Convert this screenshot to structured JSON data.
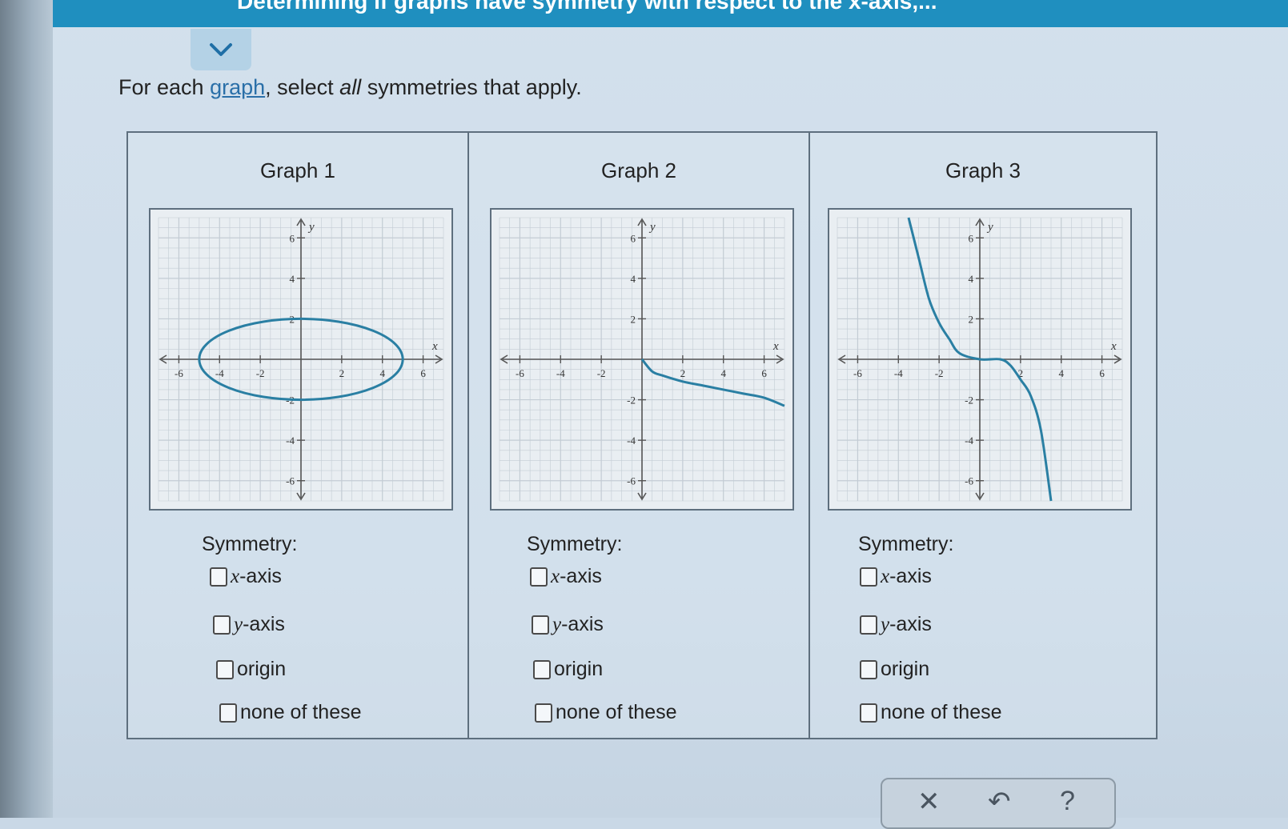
{
  "header": {
    "title": "Determining if graphs have symmetry with respect to the x-axis,..."
  },
  "prompt": {
    "before": "For each ",
    "link": "graph",
    "middle": ", select ",
    "emphasis": "all",
    "after": " symmetries that apply."
  },
  "graphs": [
    {
      "title": "Graph 1",
      "symmetry_label": "Symmetry:",
      "options": [
        "x-axis",
        "y-axis",
        "origin",
        "none of these"
      ],
      "checked": [
        false,
        false,
        false,
        false
      ]
    },
    {
      "title": "Graph 2",
      "symmetry_label": "Symmetry:",
      "options": [
        "x-axis",
        "y-axis",
        "origin",
        "none of these"
      ],
      "checked": [
        false,
        false,
        false,
        false
      ]
    },
    {
      "title": "Graph 3",
      "symmetry_label": "Symmetry:",
      "options": [
        "x-axis",
        "y-axis",
        "origin",
        "none of these"
      ],
      "checked": [
        false,
        false,
        false,
        false
      ]
    }
  ],
  "axis": {
    "x_label": "x",
    "y_label": "y",
    "x_ticks": [
      "-6",
      "-4",
      "-2",
      "2",
      "4",
      "6"
    ],
    "y_ticks": [
      "6",
      "4",
      "2",
      "-2",
      "-4",
      "-6"
    ]
  },
  "chart_data": [
    {
      "type": "line",
      "title": "Graph 1",
      "xlabel": "x",
      "ylabel": "y",
      "xlim": [
        -7,
        7
      ],
      "ylim": [
        -7,
        7
      ],
      "grid": true,
      "series": [
        {
          "shape": "ellipse",
          "center": [
            0,
            0
          ],
          "rx": 5,
          "ry": 2
        }
      ]
    },
    {
      "type": "line",
      "title": "Graph 2",
      "xlabel": "x",
      "ylabel": "y",
      "xlim": [
        -7,
        7
      ],
      "ylim": [
        -7,
        7
      ],
      "grid": true,
      "series": [
        {
          "x": [
            0,
            0.5,
            1,
            2,
            3,
            4,
            5,
            6,
            7
          ],
          "y": [
            0,
            -0.6,
            -0.8,
            -1.1,
            -1.3,
            -1.5,
            -1.7,
            -1.9,
            -2.3
          ]
        }
      ]
    },
    {
      "type": "line",
      "title": "Graph 3",
      "xlabel": "x",
      "ylabel": "y",
      "xlim": [
        -7,
        7
      ],
      "ylim": [
        -7,
        7
      ],
      "grid": true,
      "series": [
        {
          "x": [
            -3.5,
            -3,
            -2.5,
            -2,
            -1.5,
            -1,
            0,
            1,
            1.5,
            2,
            2.5,
            3,
            3.5
          ],
          "y": [
            7,
            5,
            3,
            1.8,
            1,
            0.3,
            0,
            0,
            -0.3,
            -1,
            -1.8,
            -3.5,
            -7
          ]
        }
      ]
    }
  ],
  "toolbar": {
    "close_glyph": "✕",
    "undo_glyph": "↶",
    "help_glyph": "?"
  }
}
